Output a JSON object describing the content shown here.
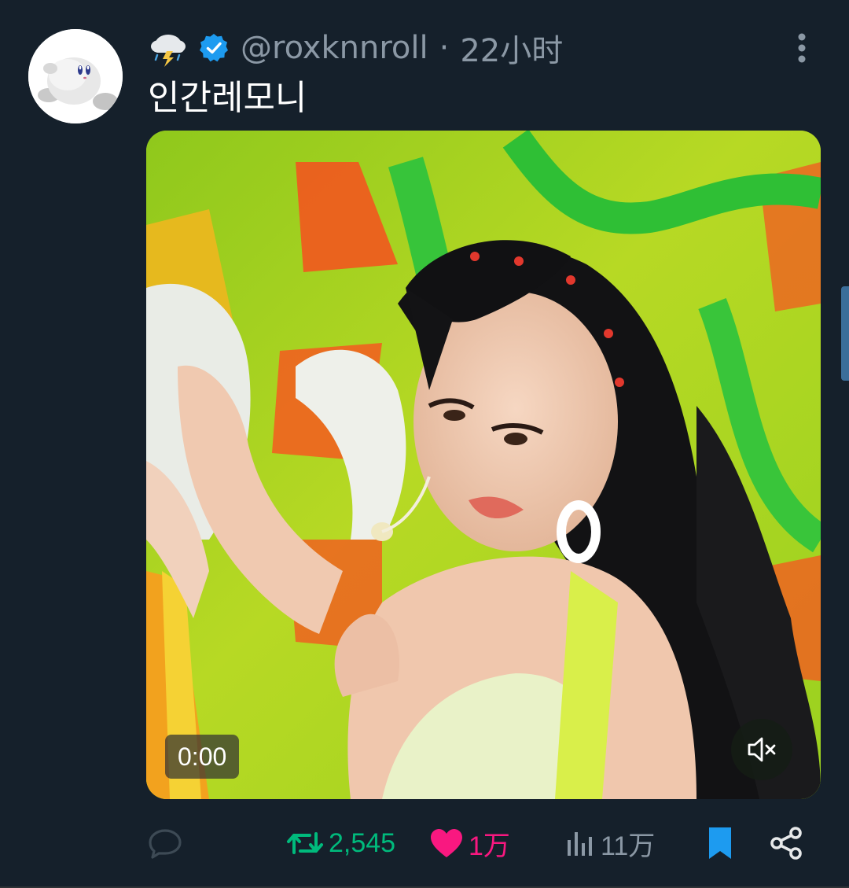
{
  "tweet": {
    "emoji_icon": "storm-cloud-icon",
    "verified": true,
    "handle": "@roxknnroll",
    "separator": "·",
    "time": "22小时",
    "text": "인간레모니"
  },
  "media": {
    "type": "video",
    "timestamp": "0:00",
    "muted": true
  },
  "actions": {
    "reply_count": "",
    "retweet_count": "2,545",
    "like_count": "1万",
    "views_count": "11万",
    "bookmarked": true
  },
  "colors": {
    "background": "#15202b",
    "retweet": "#00ba7c",
    "like": "#f91880",
    "bookmark": "#1d9bf0",
    "verified": "#1d9bf0",
    "muted_text": "#8b98a5"
  }
}
